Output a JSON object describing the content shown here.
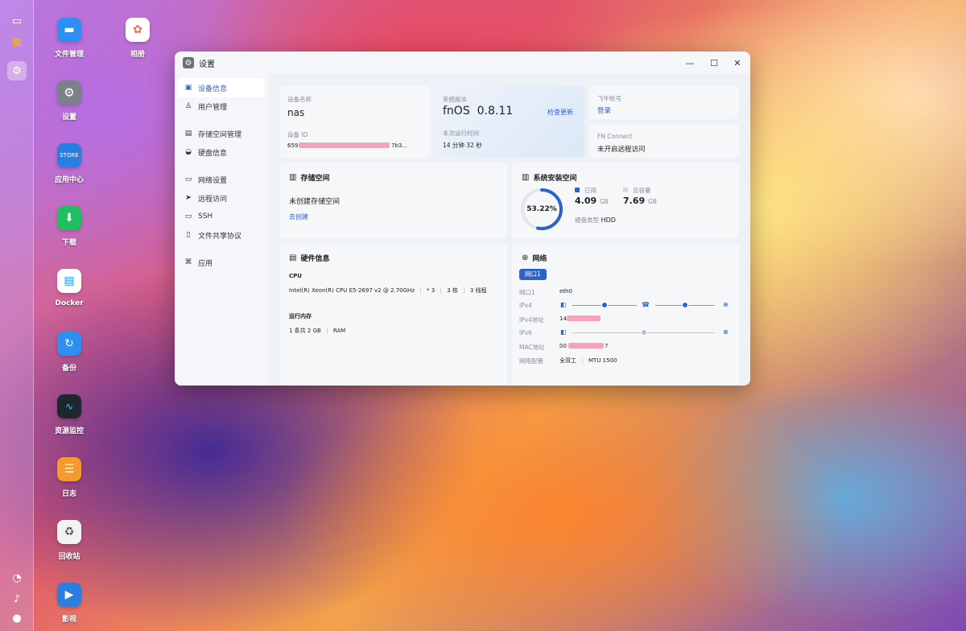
{
  "window": {
    "title": "设置"
  },
  "desktop": [
    {
      "label": "文件管理"
    },
    {
      "label": "相册"
    },
    {
      "label": "设置"
    },
    {
      "label": "应用中心"
    },
    {
      "label": "下载"
    },
    {
      "label": "Docker"
    },
    {
      "label": "备份"
    },
    {
      "label": "资源监控"
    },
    {
      "label": "日志"
    },
    {
      "label": "回收站"
    },
    {
      "label": "影视"
    }
  ],
  "sidebar": {
    "items": [
      {
        "label": "设备信息"
      },
      {
        "label": "用户管理"
      },
      {
        "label": "存储空间管理"
      },
      {
        "label": "硬盘信息"
      },
      {
        "label": "网络设置"
      },
      {
        "label": "远程访问"
      },
      {
        "label": "SSH"
      },
      {
        "label": "文件共享协议"
      },
      {
        "label": "应用"
      }
    ]
  },
  "device": {
    "name_label": "设备名称",
    "name": "nas",
    "id_label": "设备 ID",
    "id_prefix": "659",
    "id_suffix": "7b3...",
    "os_label": "系统版本",
    "os": "fnOS",
    "version": "0.8.11",
    "check_update": "检查更新",
    "uptime_label": "本次运行时间",
    "uptime": "14 分钟 32 秒",
    "account_label": "飞牛账号",
    "login": "登录",
    "fn_connect_label": "FN Connect",
    "fn_connect_status": "未开启远程访问"
  },
  "storage": {
    "title": "存储空间",
    "status": "未创建存储空间",
    "create": "去创建"
  },
  "system_space": {
    "title": "系统安装空间",
    "percent": "53.22%",
    "used_fraction": 0.5322,
    "used_label": "已用",
    "used": "4.09",
    "used_unit": "GB",
    "total_label": "总容量",
    "total": "7.69",
    "total_unit": "GB",
    "disk_type_label": "硬盘类型",
    "disk_type": "HDD"
  },
  "hardware": {
    "title": "硬件信息",
    "cpu_label": "CPU",
    "cpu_model": "Intel(R) Xeon(R) CPU E5-2697 v2 @ 2.70GHz",
    "cpu_count": "* 3",
    "cores": "3 核",
    "threads": "3 线程",
    "mem_label": "运行内存",
    "mem_sticks": "1 条共 2 GB",
    "mem_type": "RAM"
  },
  "network": {
    "title": "网络",
    "tab": "网口1",
    "rows": [
      {
        "label": "网口1",
        "value": "eth0"
      },
      {
        "label": "IPv4",
        "value": ""
      },
      {
        "label": "IPv4地址",
        "value": "14"
      },
      {
        "label": "IPv6",
        "value": ""
      },
      {
        "label": "MAC地址",
        "value": "00",
        "suffix": "7"
      },
      {
        "label": "网络配置",
        "value": "全双工",
        "mtu": "MTU 1500"
      }
    ]
  },
  "colors": {
    "accent": "#2d63c8",
    "redact": "#f4a3bd"
  }
}
